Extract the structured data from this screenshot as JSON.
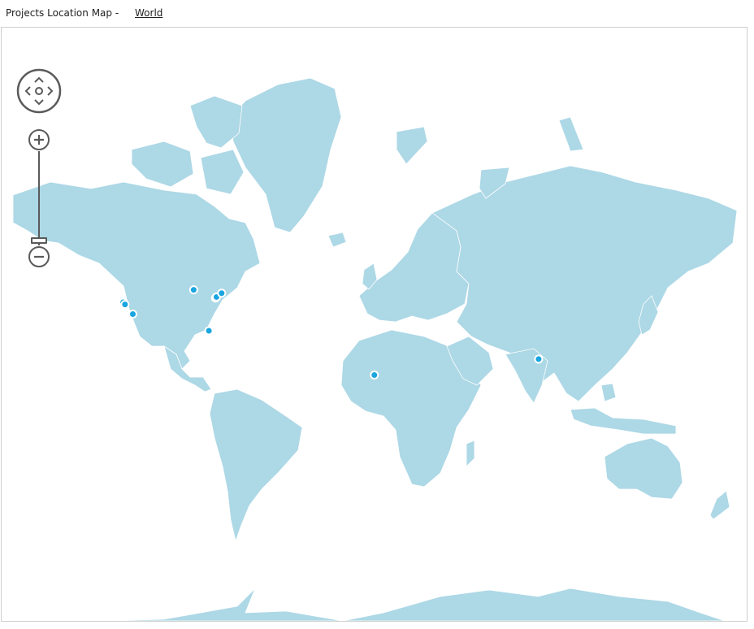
{
  "header": {
    "title": "Projects Location Map -",
    "breadcrumb_link": "World"
  },
  "colors": {
    "land": "#add8e6",
    "marker": "#1aa5e0",
    "control": "#5a5a5a"
  },
  "map": {
    "markers": [
      {
        "lon": -122.4,
        "lat": 37.8
      },
      {
        "lon": -121.9,
        "lat": 37.3
      },
      {
        "lon": -121.0,
        "lat": 36.5
      },
      {
        "lon": -117.2,
        "lat": 32.7
      },
      {
        "lon": -80.2,
        "lat": 25.8
      },
      {
        "lon": -87.6,
        "lat": 41.9
      },
      {
        "lon": -77.0,
        "lat": 38.9
      },
      {
        "lon": -76.5,
        "lat": 39.3
      },
      {
        "lon": -74.0,
        "lat": 40.7
      },
      {
        "lon": 80.2,
        "lat": 13.1
      },
      {
        "lon": 0.3,
        "lat": 5.6
      }
    ]
  }
}
